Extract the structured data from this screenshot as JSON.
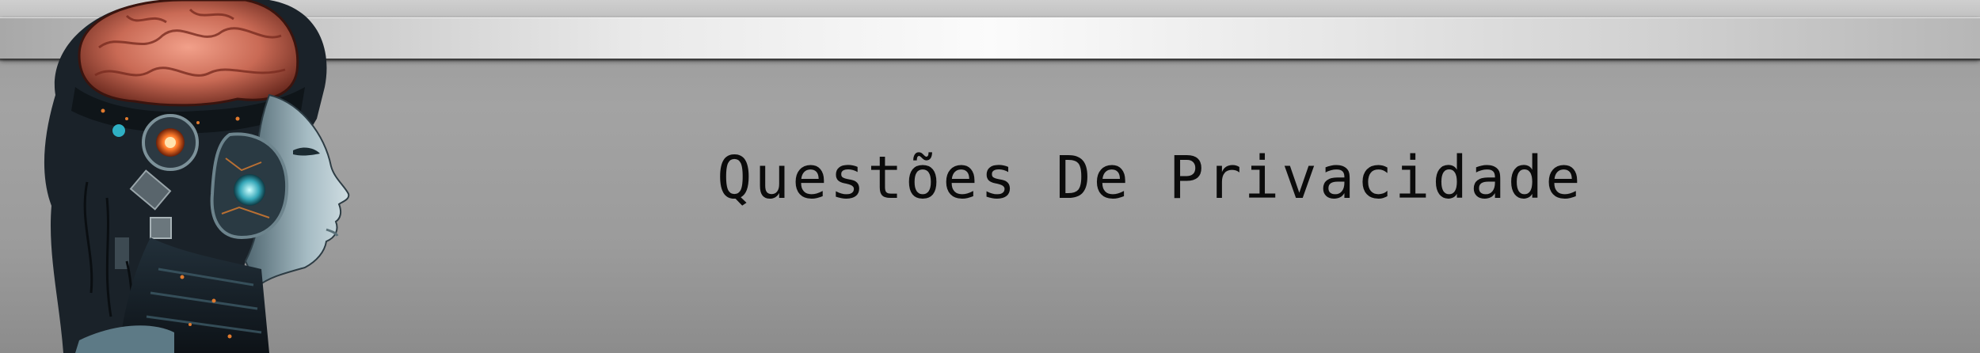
{
  "banner": {
    "title": "Questões De Privacidade",
    "background_color": "#9d9d9d",
    "bar_color": "#f5f5f5",
    "title_color": "#0b0b0b"
  },
  "illustration": {
    "icon": "robot-head-with-brain-icon"
  }
}
